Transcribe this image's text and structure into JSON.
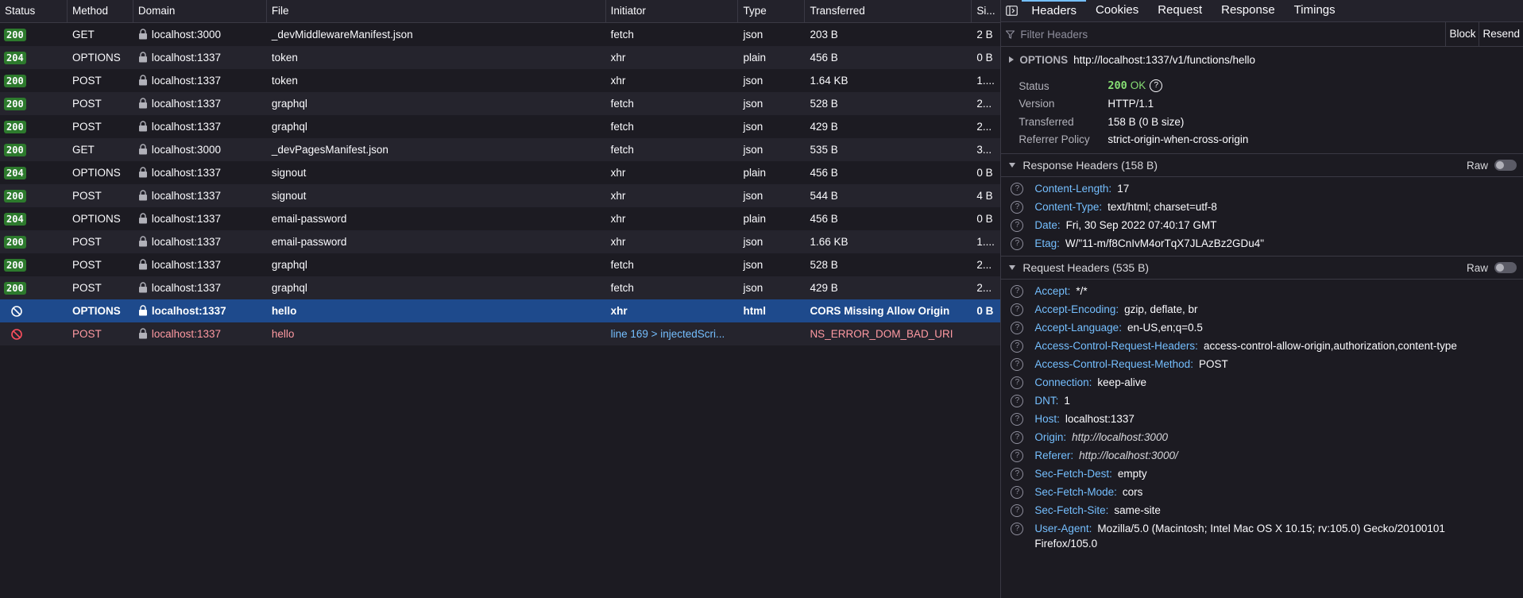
{
  "table": {
    "columns": [
      "Status",
      "Method",
      "Domain",
      "File",
      "Initiator",
      "Type",
      "Transferred",
      "Si..."
    ],
    "rows": [
      {
        "status": "200",
        "method": "GET",
        "domain": "localhost:3000",
        "file": "_devMiddlewareManifest.json",
        "initiator": "fetch",
        "type": "json",
        "transferred": "203 B",
        "size": "2 B"
      },
      {
        "status": "204",
        "method": "OPTIONS",
        "domain": "localhost:1337",
        "file": "token",
        "initiator": "xhr",
        "type": "plain",
        "transferred": "456 B",
        "size": "0 B"
      },
      {
        "status": "200",
        "method": "POST",
        "domain": "localhost:1337",
        "file": "token",
        "initiator": "xhr",
        "type": "json",
        "transferred": "1.64 KB",
        "size": "1...."
      },
      {
        "status": "200",
        "method": "POST",
        "domain": "localhost:1337",
        "file": "graphql",
        "initiator": "fetch",
        "type": "json",
        "transferred": "528 B",
        "size": "2..."
      },
      {
        "status": "200",
        "method": "POST",
        "domain": "localhost:1337",
        "file": "graphql",
        "initiator": "fetch",
        "type": "json",
        "transferred": "429 B",
        "size": "2..."
      },
      {
        "status": "200",
        "method": "GET",
        "domain": "localhost:3000",
        "file": "_devPagesManifest.json",
        "initiator": "fetch",
        "type": "json",
        "transferred": "535 B",
        "size": "3..."
      },
      {
        "status": "204",
        "method": "OPTIONS",
        "domain": "localhost:1337",
        "file": "signout",
        "initiator": "xhr",
        "type": "plain",
        "transferred": "456 B",
        "size": "0 B"
      },
      {
        "status": "200",
        "method": "POST",
        "domain": "localhost:1337",
        "file": "signout",
        "initiator": "xhr",
        "type": "json",
        "transferred": "544 B",
        "size": "4 B"
      },
      {
        "status": "204",
        "method": "OPTIONS",
        "domain": "localhost:1337",
        "file": "email-password",
        "initiator": "xhr",
        "type": "plain",
        "transferred": "456 B",
        "size": "0 B"
      },
      {
        "status": "200",
        "method": "POST",
        "domain": "localhost:1337",
        "file": "email-password",
        "initiator": "xhr",
        "type": "json",
        "transferred": "1.66 KB",
        "size": "1...."
      },
      {
        "status": "200",
        "method": "POST",
        "domain": "localhost:1337",
        "file": "graphql",
        "initiator": "fetch",
        "type": "json",
        "transferred": "528 B",
        "size": "2..."
      },
      {
        "status": "200",
        "method": "POST",
        "domain": "localhost:1337",
        "file": "graphql",
        "initiator": "fetch",
        "type": "json",
        "transferred": "429 B",
        "size": "2..."
      },
      {
        "status": "",
        "status_icon": "blocked-icon",
        "method": "OPTIONS",
        "domain": "localhost:1337",
        "file": "hello",
        "initiator": "xhr",
        "type": "html",
        "transferred": "CORS Missing Allow Origin",
        "size": "0 B",
        "selected": true
      },
      {
        "status": "",
        "status_icon": "blocked-error-icon",
        "method": "POST",
        "domain": "localhost:1337",
        "file": "hello",
        "initiator": "line 169 > injectedScri...",
        "type": "",
        "transferred": "NS_ERROR_DOM_BAD_URI",
        "size": "",
        "error": true
      }
    ]
  },
  "side": {
    "tabs": [
      "Headers",
      "Cookies",
      "Request",
      "Response",
      "Timings"
    ],
    "active_tab": "Headers",
    "filter_placeholder": "Filter Headers",
    "block_label": "Block",
    "resend_label": "Resend",
    "summary_method": "OPTIONS",
    "summary_url": "http://localhost:1337/v1/functions/hello",
    "status_label": "Status",
    "status_code": "200",
    "status_text": "OK",
    "version_label": "Version",
    "version_value": "HTTP/1.1",
    "transferred_label": "Transferred",
    "transferred_value": "158 B (0 B size)",
    "referrer_label": "Referrer Policy",
    "referrer_value": "strict-origin-when-cross-origin",
    "response_headers_title": "Response Headers (158 B)",
    "request_headers_title": "Request Headers (535 B)",
    "raw_label": "Raw",
    "response_headers": [
      {
        "name": "Content-Length",
        "value": "17"
      },
      {
        "name": "Content-Type",
        "value": "text/html; charset=utf-8"
      },
      {
        "name": "Date",
        "value": "Fri, 30 Sep 2022 07:40:17 GMT"
      },
      {
        "name": "Etag",
        "value": "W/\"11-m/f8CnIvM4orTqX7JLAzBz2GDu4\""
      }
    ],
    "request_headers": [
      {
        "name": "Accept",
        "value": "*/*"
      },
      {
        "name": "Accept-Encoding",
        "value": "gzip, deflate, br"
      },
      {
        "name": "Accept-Language",
        "value": "en-US,en;q=0.5"
      },
      {
        "name": "Access-Control-Request-Headers",
        "value": "access-control-allow-origin,authorization,content-type"
      },
      {
        "name": "Access-Control-Request-Method",
        "value": "POST"
      },
      {
        "name": "Connection",
        "value": "keep-alive"
      },
      {
        "name": "DNT",
        "value": "1"
      },
      {
        "name": "Host",
        "value": "localhost:1337"
      },
      {
        "name": "Origin",
        "value": "http://localhost:3000",
        "italic": true
      },
      {
        "name": "Referer",
        "value": "http://localhost:3000/",
        "italic": true
      },
      {
        "name": "Sec-Fetch-Dest",
        "value": "empty"
      },
      {
        "name": "Sec-Fetch-Mode",
        "value": "cors"
      },
      {
        "name": "Sec-Fetch-Site",
        "value": "same-site"
      },
      {
        "name": "User-Agent",
        "value": "Mozilla/5.0 (Macintosh; Intel Mac OS X 10.15; rv:105.0) Gecko/20100101 Firefox/105.0",
        "wrap": true
      }
    ]
  },
  "colors": {
    "background": "#1c1b22",
    "selected_row": "#1e4a8c",
    "status_ok_badge": "#2d7a2d",
    "header_name": "#75bfff",
    "error_text": "#ff9aa2",
    "status_ok_text": "#86de74"
  }
}
